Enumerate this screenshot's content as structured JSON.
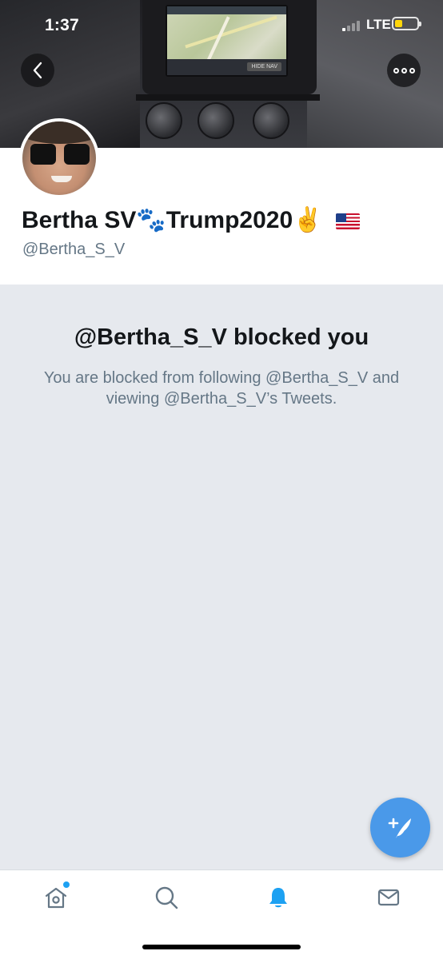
{
  "status_bar": {
    "time": "1:37",
    "network": "LTE",
    "battery_color": "#ffd60a"
  },
  "header": {
    "back_icon": "chevron-left-icon",
    "more_icon": "more-dots-icon"
  },
  "profile": {
    "display_name": "Bertha SV🐾Trump2020✌️",
    "handle": "@Bertha_S_V"
  },
  "blocked": {
    "title": "@Bertha_S_V blocked you",
    "description": "You are blocked from following @Bertha_S_V and viewing @Bertha_S_V’s Tweets."
  },
  "fab": {
    "icon": "compose-tweet-icon",
    "color": "#4a99e9"
  },
  "tabbar": {
    "items": [
      {
        "icon": "home-icon",
        "active": false,
        "has_indicator": true
      },
      {
        "icon": "search-icon",
        "active": false
      },
      {
        "icon": "bell-icon",
        "active": true
      },
      {
        "icon": "mail-icon",
        "active": false
      }
    ],
    "active_color": "#1da1f2",
    "inactive_color": "#657786"
  }
}
